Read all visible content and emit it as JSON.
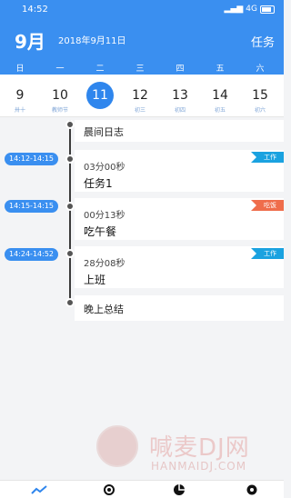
{
  "status": {
    "time": "14:52",
    "network": "4G"
  },
  "header": {
    "month": "9月",
    "date": "2018年9月11日",
    "tasks_label": "任务"
  },
  "week": [
    "日",
    "一",
    "二",
    "三",
    "四",
    "五",
    "六"
  ],
  "days": [
    {
      "num": "9",
      "sub": "卅十"
    },
    {
      "num": "10",
      "sub": "教师节"
    },
    {
      "num": "11",
      "sub": ""
    },
    {
      "num": "12",
      "sub": "初三"
    },
    {
      "num": "13",
      "sub": "初四"
    },
    {
      "num": "14",
      "sub": "初五"
    },
    {
      "num": "15",
      "sub": "初六"
    }
  ],
  "entries": {
    "morning": {
      "title": "晨间日志"
    },
    "e1": {
      "range": "14:12-14:15",
      "duration": "03分00秒",
      "name": "任务1",
      "tag": "工作"
    },
    "e2": {
      "range": "14:15-14:15",
      "duration": "00分13秒",
      "name": "吃午餐",
      "tag": "吃饭"
    },
    "e3": {
      "range": "14:24-14:52",
      "duration": "28分08秒",
      "name": "上班",
      "tag": "工作"
    },
    "evening": {
      "title": "晚上总结"
    }
  },
  "watermark": {
    "brand": "喊麦",
    "dj": "DJ网",
    "url": "HANMAIDJ.COM"
  },
  "colors": {
    "primary": "#3a8ff0",
    "work": "#1aa2e0",
    "lunch": "#ef6d4b"
  }
}
